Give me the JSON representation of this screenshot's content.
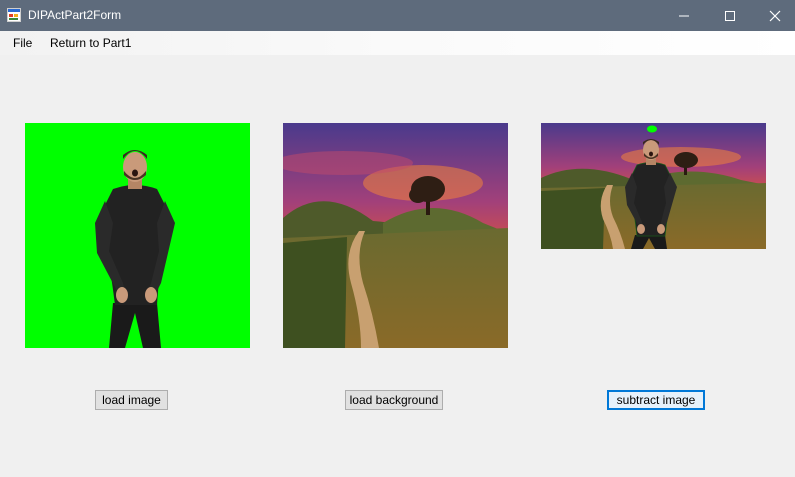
{
  "window": {
    "title": "DIPActPart2Form",
    "icon": "app-form-icon",
    "controls": [
      "minimize-icon",
      "maximize-icon",
      "close-icon"
    ]
  },
  "menu": {
    "items": [
      {
        "label": "File"
      },
      {
        "label": "Return to Part1"
      }
    ]
  },
  "images": {
    "source": "Person on green screen background",
    "background": "Sunset landscape with dirt road, hills and tree",
    "result": "Person composited onto sunset landscape"
  },
  "buttons": {
    "load_image": "load image",
    "load_background": "load background",
    "subtract_image": "subtract image"
  },
  "colors": {
    "titlebar": "#5e6b7c",
    "chroma_green": "#00ff00",
    "focus_accent": "#0078d7"
  }
}
